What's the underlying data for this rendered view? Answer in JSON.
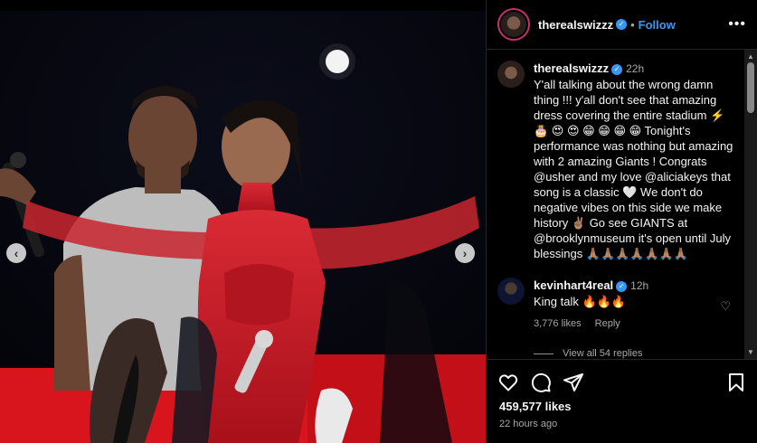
{
  "post": {
    "author": "therealswizzz",
    "follow_label": "Follow",
    "more_label": "•••",
    "separator": "•",
    "caption": {
      "username": "therealswizzz",
      "time": "22h",
      "text": "Y'all talking about the wrong damn thing !!! y'all don't see that amazing dress covering the entire stadium ⚡️ 🎂 😍 😍 😁 😁 😁 😁 Tonight's performance was nothing but amazing with 2 amazing Giants ! Congrats @usher and my love @aliciakeys that song is a classic 🤍 We don't do negative vibes on this side we make history ✌🏽 Go see GIANTS at @brooklynmuseum it's open until July blessings 🙏🏽🙏🏽🙏🏽🙏🏽🙏🏽🙏🏽🙏🏽"
    },
    "comments": [
      {
        "username": "kevinhart4real",
        "time": "12h",
        "text": "King talk 🔥🔥🔥",
        "likes": "3,776 likes",
        "reply_label": "Reply",
        "view_replies": "View all 54 replies"
      }
    ],
    "likes": "459,577 likes",
    "posted": "22 hours ago"
  },
  "icons": {
    "verified": "✓",
    "prev": "‹",
    "next": "›",
    "heart": "♡",
    "scroll_up": "▲",
    "scroll_down": "▼"
  },
  "colors": {
    "accent": "#3897f0",
    "story_ring": "#c72e6e",
    "background": "#000000"
  }
}
